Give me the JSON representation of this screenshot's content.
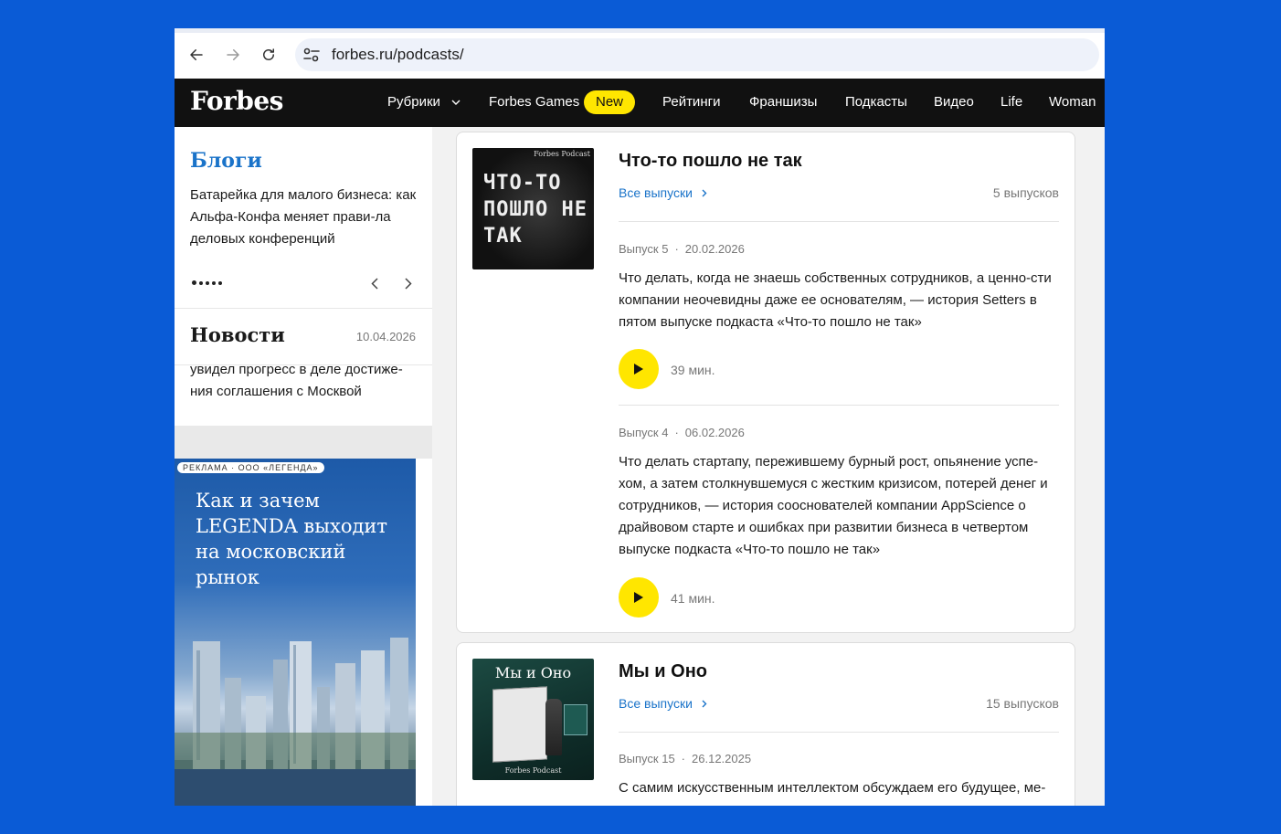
{
  "browser": {
    "url": "forbes.ru/podcasts/"
  },
  "header": {
    "logo": "Forbes",
    "menu": [
      "Рубрики",
      "Forbes Games",
      "New",
      "Рейтинги",
      "Франшизы",
      "Подкасты",
      "Видео",
      "Life",
      "Woman"
    ],
    "badge_color": "#ffe600"
  },
  "sidebar": {
    "blogs": {
      "title": "Блоги",
      "text": "Батарейка для малого бизнеса: как Альфа-Конфа меняет прави-ла деловых конференций"
    },
    "news": {
      "title": "Новости",
      "date": "10.04.2026",
      "text": "увидел прогресс в деле достиже-ния соглашения с Москвой"
    },
    "ad": {
      "label": "РЕКЛАМА · ООО «ЛЕГЕНДА»",
      "title": "Как и зачем LEGENDA выходит на московский рынок"
    }
  },
  "podcasts": [
    {
      "title": "Что-то пошло не так",
      "all_label": "Все выпуски",
      "count": "5 выпусков",
      "cover_brand": "Forbes Podcast",
      "cover_text": "ЧТО-ТО ПОШЛО НЕ ТАК",
      "episodes": [
        {
          "number": "Выпуск 5",
          "date": "20.02.2026",
          "description": "Что делать, когда не знаешь собственных сотрудников, а ценно-сти компании неочевидны даже ее основателям, — история Setters в пятом выпуске подкаста «Что-то пошло не так»",
          "duration": "39 мин."
        },
        {
          "number": "Выпуск 4",
          "date": "06.02.2026",
          "description": "Что делать стартапу, пережившему бурный рост, опьянение успе-хом, а затем столкнувшемуся с жестким кризисом, потерей денег и сотрудников, — история сооснователей компании AppScience о драйвовом старте и ошибках при развитии бизнеса в четвертом выпуске подкаста «Что-то пошло не так»",
          "duration": "41 мин."
        }
      ]
    },
    {
      "title": "Мы и Оно",
      "all_label": "Все выпуски",
      "count": "15 выпусков",
      "cover_brand": "Forbes Podcast",
      "cover_text": "Мы и Оно",
      "episodes": [
        {
          "number": "Выпуск 15",
          "date": "26.12.2025",
          "description": "С самим искусственным интеллектом обсуждаем его будущее, ме-"
        }
      ]
    }
  ]
}
